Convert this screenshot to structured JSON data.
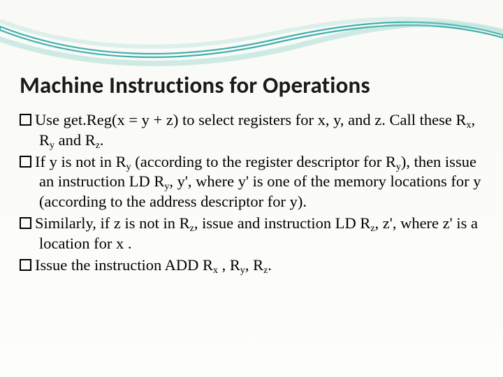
{
  "title": "Machine Instructions for Operations",
  "items": [
    {
      "t0": "Use get.Reg(x = y + z) to select registers for x, y, and z. Call these R",
      "s0": "x",
      "t1": ", R",
      "s1": "y",
      "t2": " and R",
      "s2": "z",
      "t3": "."
    },
    {
      "t0": "If y is not in R",
      "s0": "y",
      "t1": " (according to the register descriptor for R",
      "s1": "y",
      "t2": "), then issue an instruction LD R",
      "s2": "y",
      "t3": ", y', where y' is one of the memory locations for y (according to the address descriptor for y)."
    },
    {
      "t0": "Similarly, if z is not in R",
      "s0": "z",
      "t1": ", issue and instruction LD R",
      "s1": "z",
      "t2": ", z', where z' is a location for x ."
    },
    {
      "t0": "Issue the instruction ADD R",
      "s0": "x",
      "t1": " , R",
      "s1": "y",
      "t2": ", R",
      "s2": "z",
      "t3": "."
    }
  ]
}
